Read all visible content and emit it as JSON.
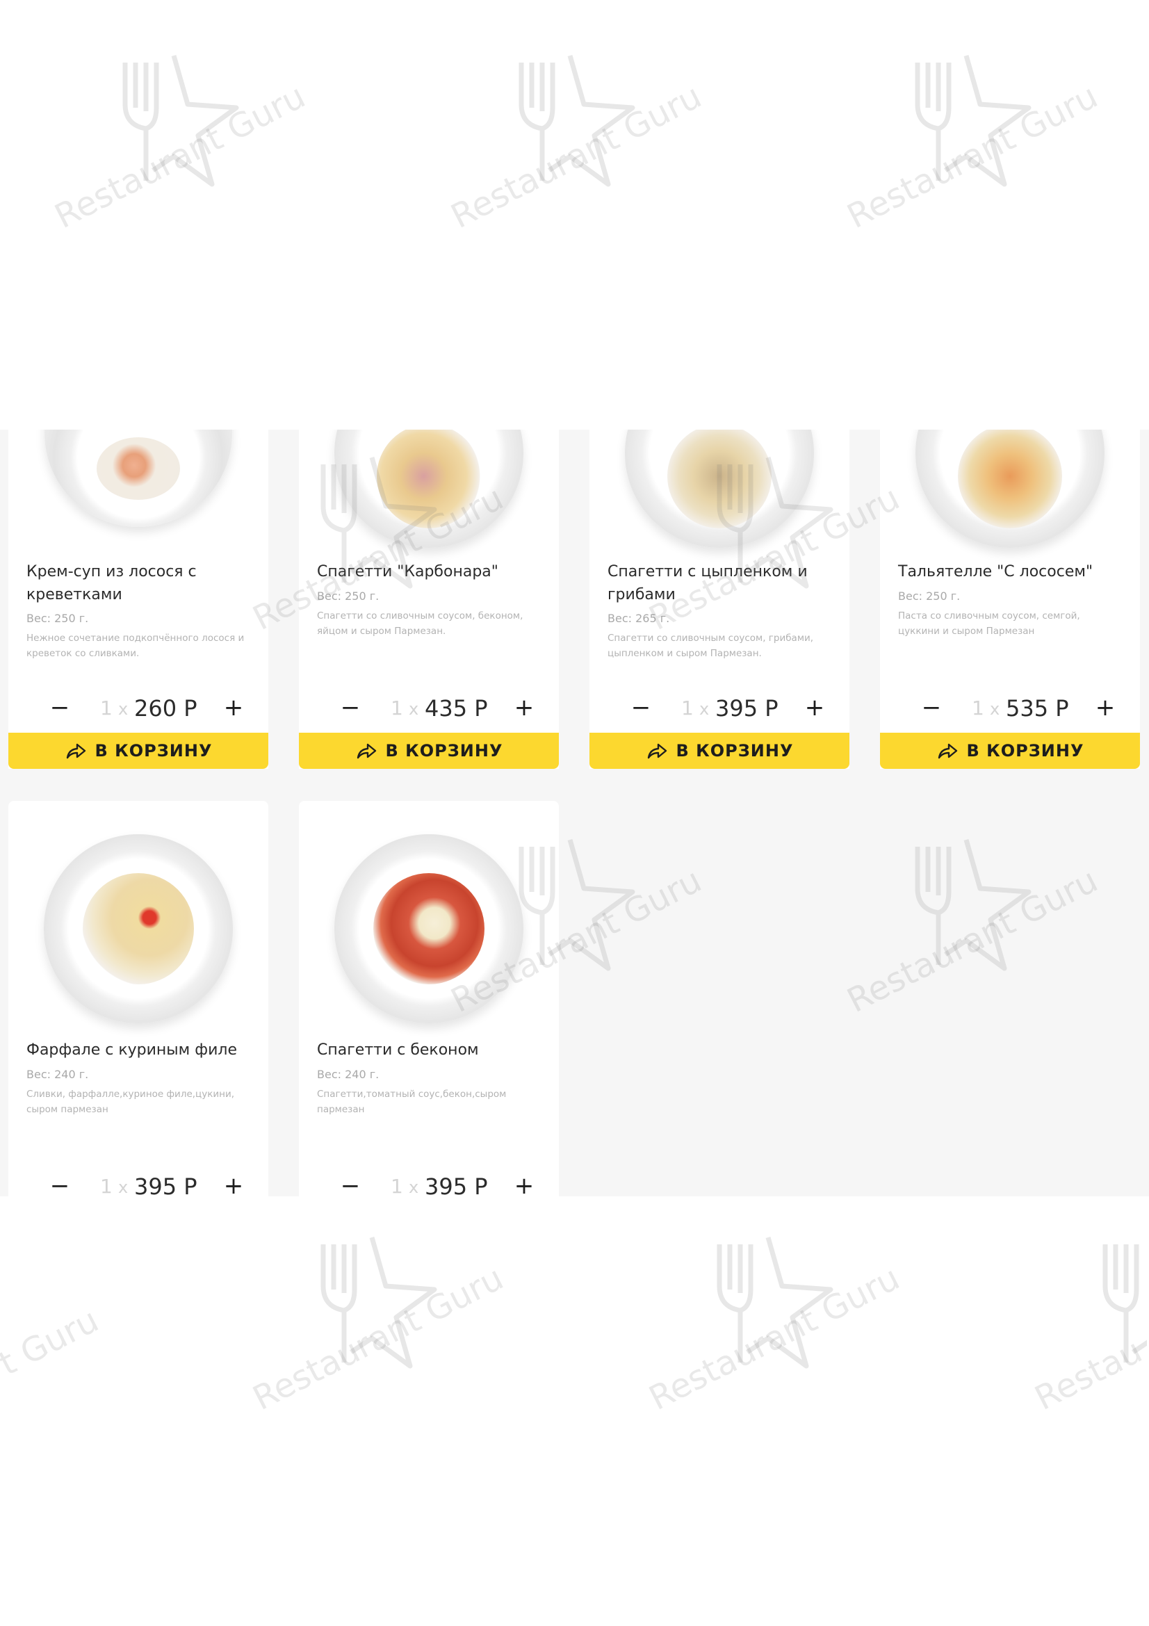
{
  "watermark": {
    "text": "Restaurant Guru",
    "text_partial_left": "t Guru",
    "text_partial_right": "Restau",
    "icon": "fork-star-icon"
  },
  "colors": {
    "accent": "#fcd82f",
    "background": "#f6f6f6",
    "card": "#ffffff",
    "muted": "#b3b3b3"
  },
  "cart_label": "В КОРЗИНУ",
  "times_sign": "x",
  "minus_sign": "−",
  "plus_sign": "+",
  "products": [
    {
      "title": "Крем-суп из лосося с креветками",
      "weight": "Вес: 250 г.",
      "description": "Нежное сочетание подкопчённого лосося и креветок со сливками.",
      "quantity": "1",
      "price": "260 Р",
      "food": "soup"
    },
    {
      "title": "Спагетти \"Карбонара\"",
      "weight": "Вес: 250 г.",
      "description": "Спагетти со сливочным соусом, беконом, яйцом и сыром Пармезан.",
      "quantity": "1",
      "price": "435 Р",
      "food": "carbonara"
    },
    {
      "title": "Спагетти с цыпленком и грибами",
      "weight": "Вес: 265 г.",
      "description": "Спагетти со сливочным соусом, грибами, цыпленком и сыром Пармезан.",
      "quantity": "1",
      "price": "395 Р",
      "food": "chicken-mushroom"
    },
    {
      "title": "Тальятелле \"С лососем\"",
      "weight": "Вес: 250 г.",
      "description": "Паста со сливочным соусом, семгой, цуккини и сыром Пармезан",
      "quantity": "1",
      "price": "535 Р",
      "food": "salmon"
    },
    {
      "title": "Фарфале с куриным филе",
      "weight": "Вес: 240 г.",
      "description": "Сливки, фарфалле,куриное филе,цукини, сыром пармезан",
      "quantity": "1",
      "price": "395 Р",
      "food": "farfalle"
    },
    {
      "title": "Спагетти с беконом",
      "weight": "Вес: 240 г.",
      "description": "Спагетти,томатный соус,бекон,сыром пармезан",
      "quantity": "1",
      "price": "395 Р",
      "food": "tomato-bacon"
    }
  ]
}
